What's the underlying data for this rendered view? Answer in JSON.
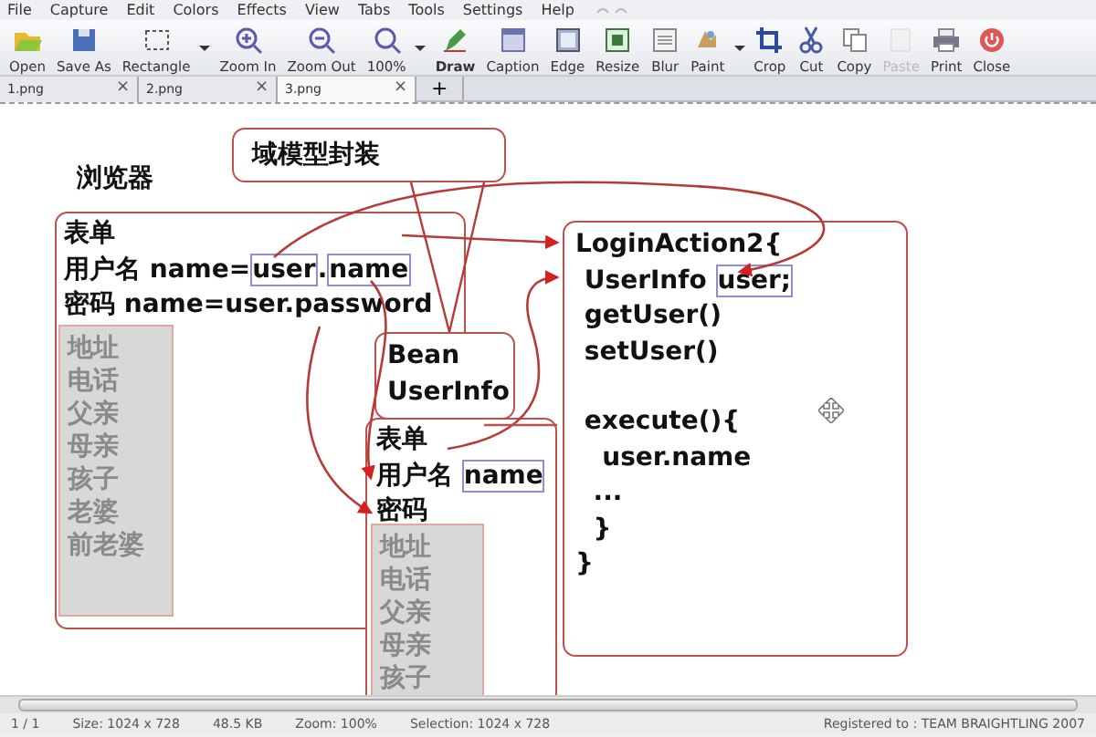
{
  "menu": [
    "File",
    "Capture",
    "Edit",
    "Colors",
    "Effects",
    "View",
    "Tabs",
    "Tools",
    "Settings",
    "Help"
  ],
  "toolbar": [
    {
      "label": "Open",
      "selected": false,
      "disabled": false,
      "dropdown": false
    },
    {
      "label": "Save As",
      "selected": false,
      "disabled": false,
      "dropdown": false
    },
    {
      "label": "Rectangle",
      "selected": false,
      "disabled": false,
      "dropdown": true
    },
    {
      "label": "Zoom In",
      "selected": false,
      "disabled": false,
      "dropdown": false
    },
    {
      "label": "Zoom Out",
      "selected": false,
      "disabled": false,
      "dropdown": false
    },
    {
      "label": "100%",
      "selected": false,
      "disabled": false,
      "dropdown": true
    },
    {
      "label": "Draw",
      "selected": true,
      "disabled": false,
      "dropdown": false
    },
    {
      "label": "Caption",
      "selected": false,
      "disabled": false,
      "dropdown": false
    },
    {
      "label": "Edge",
      "selected": false,
      "disabled": false,
      "dropdown": false
    },
    {
      "label": "Resize",
      "selected": false,
      "disabled": false,
      "dropdown": false
    },
    {
      "label": "Blur",
      "selected": false,
      "disabled": false,
      "dropdown": false
    },
    {
      "label": "Paint",
      "selected": false,
      "disabled": false,
      "dropdown": true
    },
    {
      "label": "Crop",
      "selected": false,
      "disabled": false,
      "dropdown": false
    },
    {
      "label": "Cut",
      "selected": false,
      "disabled": false,
      "dropdown": false
    },
    {
      "label": "Copy",
      "selected": false,
      "disabled": false,
      "dropdown": false
    },
    {
      "label": "Paste",
      "selected": false,
      "disabled": true,
      "dropdown": false
    },
    {
      "label": "Print",
      "selected": false,
      "disabled": false,
      "dropdown": false
    },
    {
      "label": "Close",
      "selected": false,
      "disabled": false,
      "dropdown": false
    }
  ],
  "tabs": [
    {
      "label": "1.png",
      "close": "×",
      "selected": false
    },
    {
      "label": "2.png",
      "close": "×",
      "selected": false
    },
    {
      "label": "3.png",
      "close": "×",
      "selected": true
    }
  ],
  "new_tab": "+",
  "diagram": {
    "title_box": "域模型封装",
    "browser_label": "浏览器",
    "browser_form": {
      "lines": [
        [
          {
            "text": "表单",
            "boxed": false
          }
        ],
        [
          {
            "text": "用户名 name=",
            "boxed": false
          },
          {
            "text": "user",
            "boxed": true
          },
          {
            "text": ".",
            "boxed": false
          },
          {
            "text": "name",
            "boxed": true
          }
        ],
        [
          {
            "text": "密码 name=user.password",
            "boxed": false
          }
        ]
      ],
      "list": [
        "地址",
        "电话",
        "父亲",
        "母亲",
        "孩子",
        "老婆",
        "前老婆"
      ]
    },
    "bean_box": [
      "Bean",
      "UserInfo"
    ],
    "action_form": {
      "lines": [
        [
          {
            "text": "表单",
            "boxed": false
          }
        ],
        [
          {
            "text": "用户名 ",
            "boxed": false
          },
          {
            "text": "name",
            "boxed": true
          }
        ],
        [
          {
            "text": "密码",
            "boxed": false
          }
        ]
      ],
      "list": [
        "地址",
        "电话",
        "父亲",
        "母亲",
        "孩子"
      ]
    },
    "action_class": {
      "top_lines": [
        [
          {
            "text": "LoginAction2{",
            "boxed": false
          }
        ],
        [
          {
            "text": " UserInfo ",
            "boxed": false
          },
          {
            "text": "user;",
            "boxed": true
          }
        ],
        [
          {
            "text": " getUser()",
            "boxed": false
          }
        ],
        [
          {
            "text": " setUser()",
            "boxed": false
          }
        ]
      ],
      "bottom_lines": [
        [
          {
            "text": " execute(){",
            "boxed": false
          }
        ],
        [
          {
            "text": "   user.name",
            "boxed": false
          }
        ],
        [
          {
            "text": "  ...",
            "boxed": false
          }
        ],
        [
          {
            "text": "  }",
            "boxed": false
          }
        ],
        [
          {
            "text": "}",
            "boxed": false
          }
        ]
      ]
    }
  },
  "status_bar": [
    "1 / 1",
    "Size: 1024 x 728",
    "48.5 KB",
    "Zoom: 100%",
    "Selection: 1024 x 728",
    "Registered to : TEAM BRAIGHTLING 2007"
  ]
}
